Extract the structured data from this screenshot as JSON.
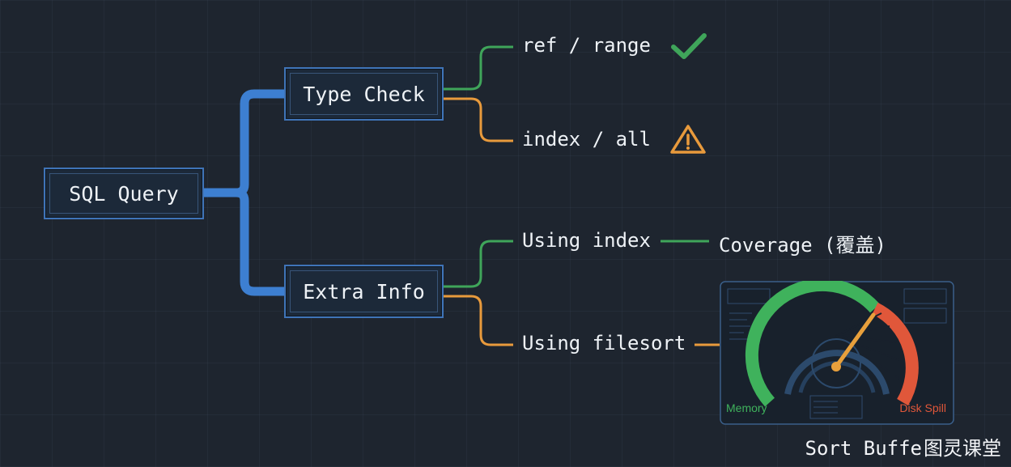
{
  "root": {
    "label": "SQL Query"
  },
  "branches": [
    {
      "label": "Type Check",
      "children": [
        {
          "label": "ref / range",
          "status": "ok",
          "color": "#3fa55a",
          "icon": "check-icon"
        },
        {
          "label": "index / all",
          "status": "warning",
          "color": "#e89a3c",
          "icon": "warning-icon"
        }
      ]
    },
    {
      "label": "Extra Info",
      "children": [
        {
          "label": "Using index",
          "color": "#3fa55a",
          "note": "Coverage (覆盖)"
        },
        {
          "label": "Using filesort",
          "color": "#e89a3c"
        }
      ]
    }
  ],
  "gauge": {
    "left_label": "Memory",
    "right_label": "Disk Spill",
    "left_color": "#3fb25c",
    "right_color": "#e0573a",
    "needle_color": "#e8a03c"
  },
  "footer": {
    "caption": "Sort Buffe",
    "logo": "图灵课堂"
  },
  "colors": {
    "trunk": "#3d7fd1",
    "ok": "#3fa55a",
    "warn": "#e89a3c",
    "background": "#1e252f"
  }
}
